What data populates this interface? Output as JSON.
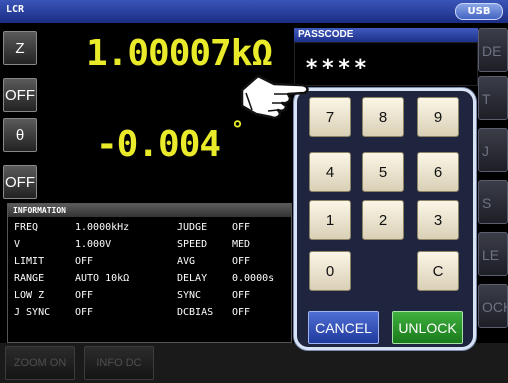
{
  "header": {
    "mode": "LCR",
    "usb_label": "USB"
  },
  "side_buttons": [
    "Z",
    "OFF",
    "θ",
    "OFF"
  ],
  "measurement": {
    "primary_value": "1.00007kΩ",
    "secondary_value": "-0.004",
    "secondary_unit": "°"
  },
  "right_buttons": [
    "DE",
    "T",
    "J",
    "S",
    "LE",
    "OCK"
  ],
  "info": {
    "title": "INFORMATION",
    "rows": [
      [
        "FREQ",
        "1.0000kHz",
        "JUDGE",
        "OFF"
      ],
      [
        "V",
        "1.000V",
        "SPEED",
        "MED"
      ],
      [
        "LIMIT",
        "OFF",
        "AVG",
        "OFF"
      ],
      [
        "RANGE",
        "AUTO  10kΩ",
        "DELAY",
        "0.0000s"
      ],
      [
        "LOW Z",
        "OFF",
        "SYNC",
        "OFF"
      ],
      [
        "J SYNC",
        "OFF",
        "DCBIAS",
        "OFF"
      ]
    ]
  },
  "bottom_buttons": [
    "ZOOM ON",
    "INFO DC"
  ],
  "passcode": {
    "title": "PASSCODE",
    "value": "****",
    "keys": [
      "7",
      "8",
      "9",
      "4",
      "5",
      "6",
      "1",
      "2",
      "3",
      "0",
      "C"
    ],
    "cancel_label": "CANCEL",
    "unlock_label": "UNLOCK"
  },
  "colors": {
    "measure": "#e8ea2a",
    "title_bar": "#2a40a0",
    "unlock": "#2f9a2f",
    "cancel": "#3553bb",
    "key_face": "#f0e9d4"
  },
  "icons": {
    "pointer": "pointing-hand-icon"
  }
}
